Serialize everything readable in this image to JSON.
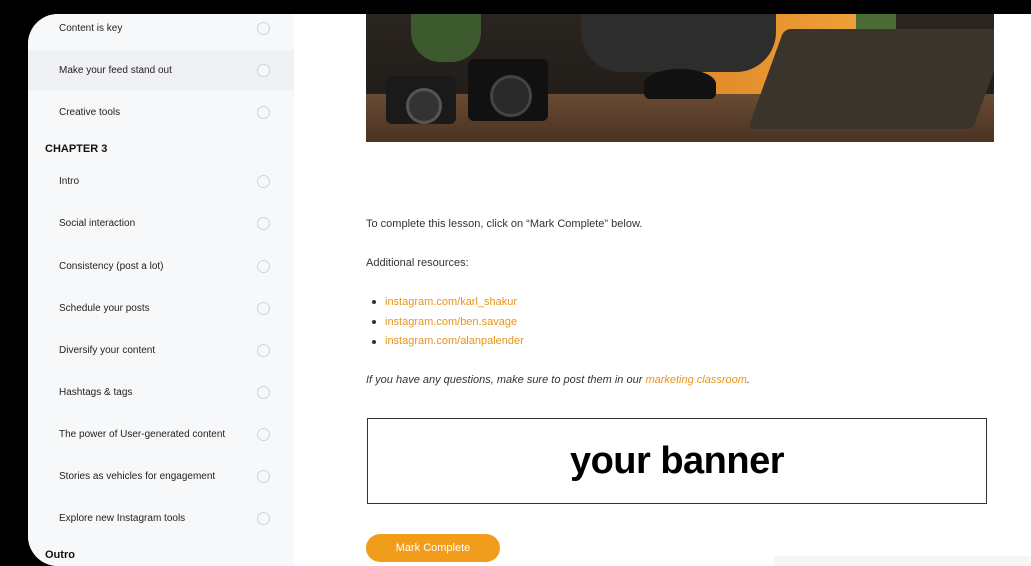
{
  "sidebar": {
    "lessons_top": [
      {
        "label": "Content is key"
      },
      {
        "label": "Make your feed stand out"
      },
      {
        "label": "Creative tools"
      }
    ],
    "chapter3": "CHAPTER 3",
    "lessons_ch3": [
      {
        "label": "Intro"
      },
      {
        "label": "Social interaction"
      },
      {
        "label": "Consistency (post a lot)"
      },
      {
        "label": "Schedule your posts"
      },
      {
        "label": "Diversify your content"
      },
      {
        "label": "Hashtags & tags"
      },
      {
        "label": "The power of User-generated content"
      },
      {
        "label": "Stories as vehicles for engagement"
      },
      {
        "label": "Explore new Instagram tools"
      }
    ],
    "outro": "Outro"
  },
  "main": {
    "instruction": "To complete this lesson, click on “Mark Complete” below.",
    "resources_heading": "Additional resources:",
    "links": [
      "instagram.com/karl_shakur",
      "instagram.com/ben.savage",
      "instagram.com/alanpalender"
    ],
    "question_prefix": "If you have any questions, make sure to post them in our ",
    "question_link": "marketing classroom",
    "question_suffix": ".",
    "banner_text": "your banner",
    "mark_complete": "Mark Complete"
  },
  "colors": {
    "accent": "#f19c1a",
    "link": "#e89418"
  }
}
